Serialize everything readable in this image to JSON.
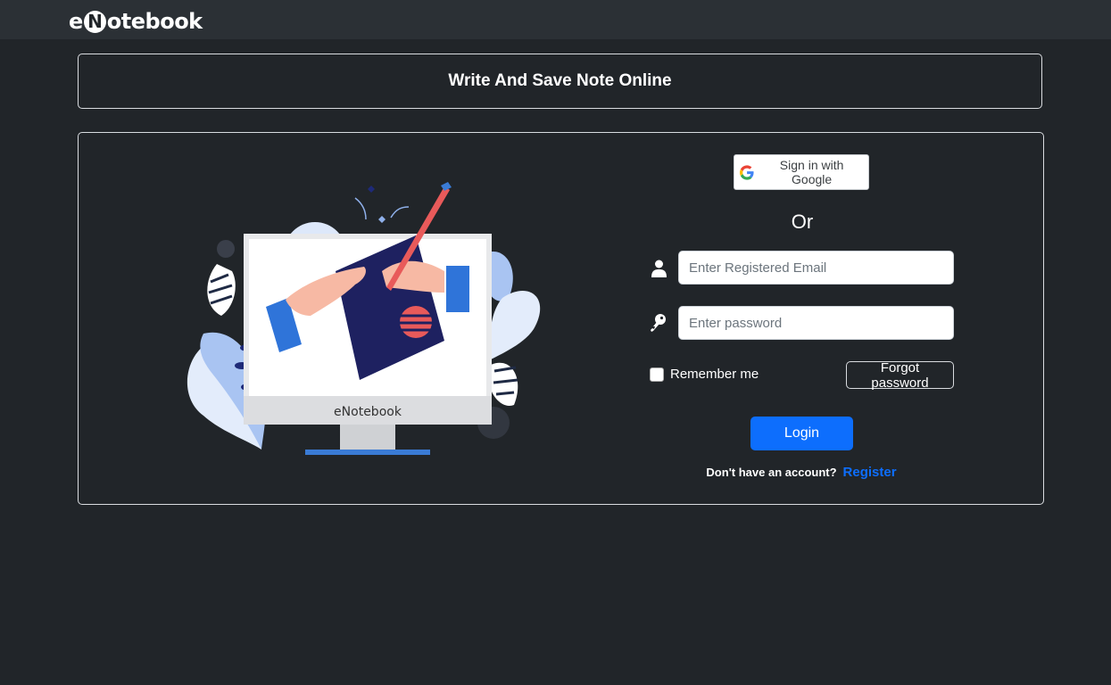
{
  "navbar": {
    "brand_prefix": "e",
    "brand_circle": "N",
    "brand_suffix": "otebook"
  },
  "header": {
    "title": "Write And Save Note Online"
  },
  "illustration": {
    "screen_label": "eNotebook"
  },
  "login": {
    "google_label": "Sign in with Google",
    "or_text": "Or",
    "email_placeholder": "Enter Registered Email",
    "password_placeholder": "Enter password",
    "remember_label": "Remember me",
    "forgot_label": "Forgot password",
    "login_label": "Login",
    "no_account_text": "Don't have an account?",
    "register_label": "Register"
  },
  "colors": {
    "background": "#212529",
    "navbar": "#2b3035",
    "primary": "#0d6efd"
  },
  "icons": [
    "google-icon",
    "user-icon",
    "key-icon"
  ]
}
